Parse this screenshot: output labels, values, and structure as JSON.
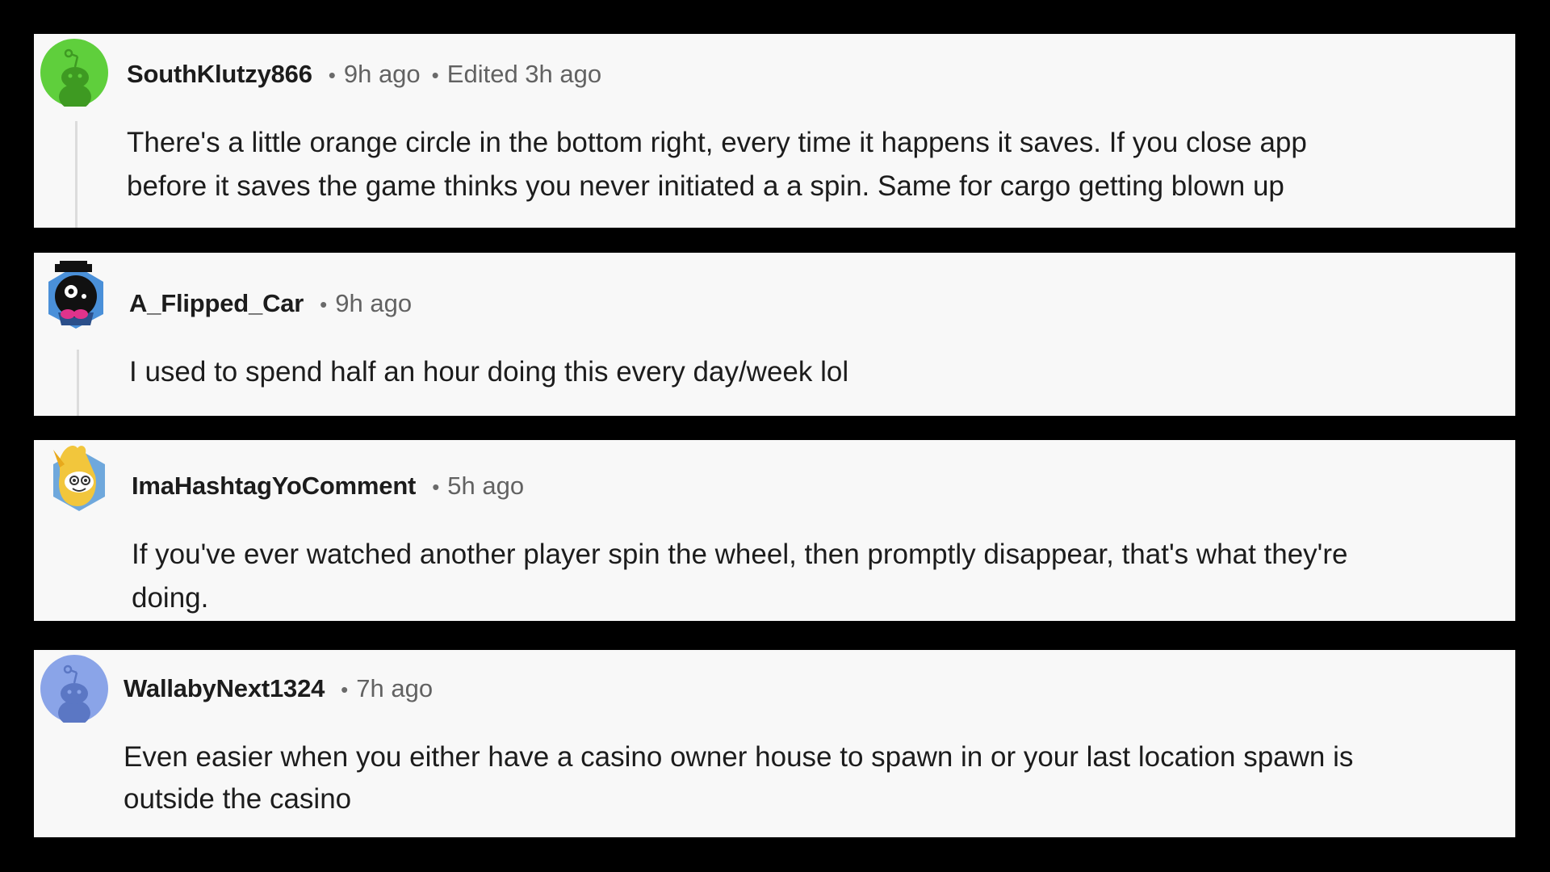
{
  "comments": [
    {
      "username": "SouthKlutzy866",
      "time": "9h ago",
      "edited": "Edited 3h ago",
      "avatar_icon": "green-snoo-avatar-icon",
      "avatar_color": "#5fcf3c",
      "lines": [
        "There's a little orange circle in the bottom right, every time it happens it saves. If you close app",
        "before it saves the game thinks you never initiated a a spin. Same for cargo getting blown up"
      ]
    },
    {
      "username": "A_Flipped_Car",
      "time": "9h ago",
      "avatar_icon": "black-robot-snoo-avatar-icon",
      "avatar_color": "#4a90d9",
      "lines": [
        "I used to spend half an hour doing this every day/week lol"
      ]
    },
    {
      "username": "ImaHashtagYoComment",
      "time": "5h ago",
      "avatar_icon": "yellow-corn-snoo-avatar-icon",
      "avatar_color": "#f2c63c",
      "lines": [
        "If you've ever watched another player spin the wheel, then promptly disappear, that's what they're",
        "doing."
      ]
    },
    {
      "username": "WallabyNext1324",
      "time": "7h ago",
      "avatar_icon": "blue-snoo-avatar-icon",
      "avatar_color": "#8aa4e8",
      "lines": [
        "Even easier when you either have a casino owner house to spawn in or your last location spawn is",
        "outside the casino"
      ]
    }
  ]
}
